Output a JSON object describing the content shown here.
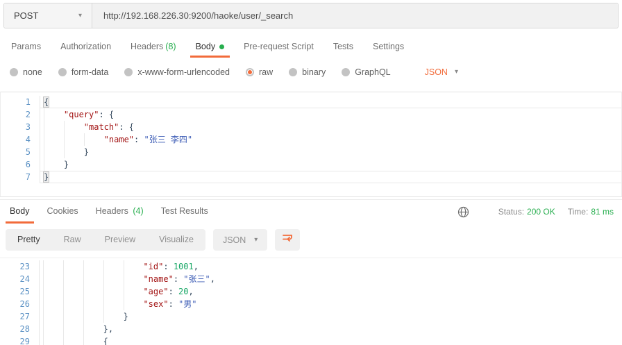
{
  "colors": {
    "accent_orange": "#f26b3a",
    "success_green": "#27ae4e",
    "line_number_blue": "#5b91c4",
    "json_key": "#a31515",
    "json_string": "#3b5bb5",
    "json_number": "#16a765"
  },
  "request": {
    "method": "POST",
    "url": "http://192.168.226.30:9200/haoke/user/_search",
    "tabs": [
      {
        "label": "Params"
      },
      {
        "label": "Authorization"
      },
      {
        "label": "Headers",
        "count": "(8)"
      },
      {
        "label": "Body",
        "active": true,
        "dot": true
      },
      {
        "label": "Pre-request Script"
      },
      {
        "label": "Tests"
      },
      {
        "label": "Settings"
      }
    ],
    "body_types": [
      {
        "label": "none"
      },
      {
        "label": "form-data"
      },
      {
        "label": "x-www-form-urlencoded"
      },
      {
        "label": "raw",
        "selected": true
      },
      {
        "label": "binary"
      },
      {
        "label": "GraphQL"
      }
    ],
    "raw_format": "JSON"
  },
  "request_editor": {
    "lines": [
      {
        "num": 1,
        "indent": 0,
        "hl_bottom": true,
        "tokens": [
          {
            "t": "punct-hl",
            "v": "{"
          }
        ]
      },
      {
        "num": 2,
        "indent": 1,
        "tokens": [
          {
            "t": "key",
            "v": "\"query\""
          },
          {
            "t": "punct",
            "v": ": {"
          }
        ]
      },
      {
        "num": 3,
        "indent": 2,
        "tokens": [
          {
            "t": "key",
            "v": "\"match\""
          },
          {
            "t": "punct",
            "v": ": {"
          }
        ]
      },
      {
        "num": 4,
        "indent": 3,
        "tokens": [
          {
            "t": "key",
            "v": "\"name\""
          },
          {
            "t": "punct",
            "v": ": "
          },
          {
            "t": "string",
            "v": "\"张三 李四\""
          }
        ]
      },
      {
        "num": 5,
        "indent": 2,
        "tokens": [
          {
            "t": "punct",
            "v": "}"
          }
        ]
      },
      {
        "num": 6,
        "indent": 1,
        "tokens": [
          {
            "t": "punct",
            "v": "}"
          }
        ]
      },
      {
        "num": 7,
        "indent": 0,
        "hl_top": true,
        "hl_bottom": true,
        "tokens": [
          {
            "t": "punct-hl",
            "v": "}"
          }
        ]
      }
    ]
  },
  "response": {
    "tabs": [
      {
        "label": "Body",
        "active": true
      },
      {
        "label": "Cookies"
      },
      {
        "label": "Headers",
        "count": "(4)"
      },
      {
        "label": "Test Results"
      }
    ],
    "status_label": "Status:",
    "status_value": "200 OK",
    "time_label": "Time:",
    "time_value": "81 ms",
    "view_modes": [
      {
        "label": "Pretty",
        "active": true
      },
      {
        "label": "Raw"
      },
      {
        "label": "Preview"
      },
      {
        "label": "Visualize"
      }
    ],
    "format": "JSON"
  },
  "response_editor": {
    "lines": [
      {
        "num": 23,
        "indent": 5,
        "tokens": [
          {
            "t": "key",
            "v": "\"id\""
          },
          {
            "t": "punct",
            "v": ": "
          },
          {
            "t": "number",
            "v": "1001"
          },
          {
            "t": "punct",
            "v": ","
          }
        ]
      },
      {
        "num": 24,
        "indent": 5,
        "tokens": [
          {
            "t": "key",
            "v": "\"name\""
          },
          {
            "t": "punct",
            "v": ": "
          },
          {
            "t": "string",
            "v": "\"张三\""
          },
          {
            "t": "punct",
            "v": ","
          }
        ]
      },
      {
        "num": 25,
        "indent": 5,
        "tokens": [
          {
            "t": "key",
            "v": "\"age\""
          },
          {
            "t": "punct",
            "v": ": "
          },
          {
            "t": "number",
            "v": "20"
          },
          {
            "t": "punct",
            "v": ","
          }
        ]
      },
      {
        "num": 26,
        "indent": 5,
        "tokens": [
          {
            "t": "key",
            "v": "\"sex\""
          },
          {
            "t": "punct",
            "v": ": "
          },
          {
            "t": "string",
            "v": "\"男\""
          }
        ]
      },
      {
        "num": 27,
        "indent": 4,
        "tokens": [
          {
            "t": "punct",
            "v": "}"
          }
        ]
      },
      {
        "num": 28,
        "indent": 3,
        "tokens": [
          {
            "t": "punct",
            "v": "},"
          }
        ]
      },
      {
        "num": 29,
        "indent": 3,
        "tokens": [
          {
            "t": "punct",
            "v": "{"
          }
        ]
      }
    ]
  }
}
